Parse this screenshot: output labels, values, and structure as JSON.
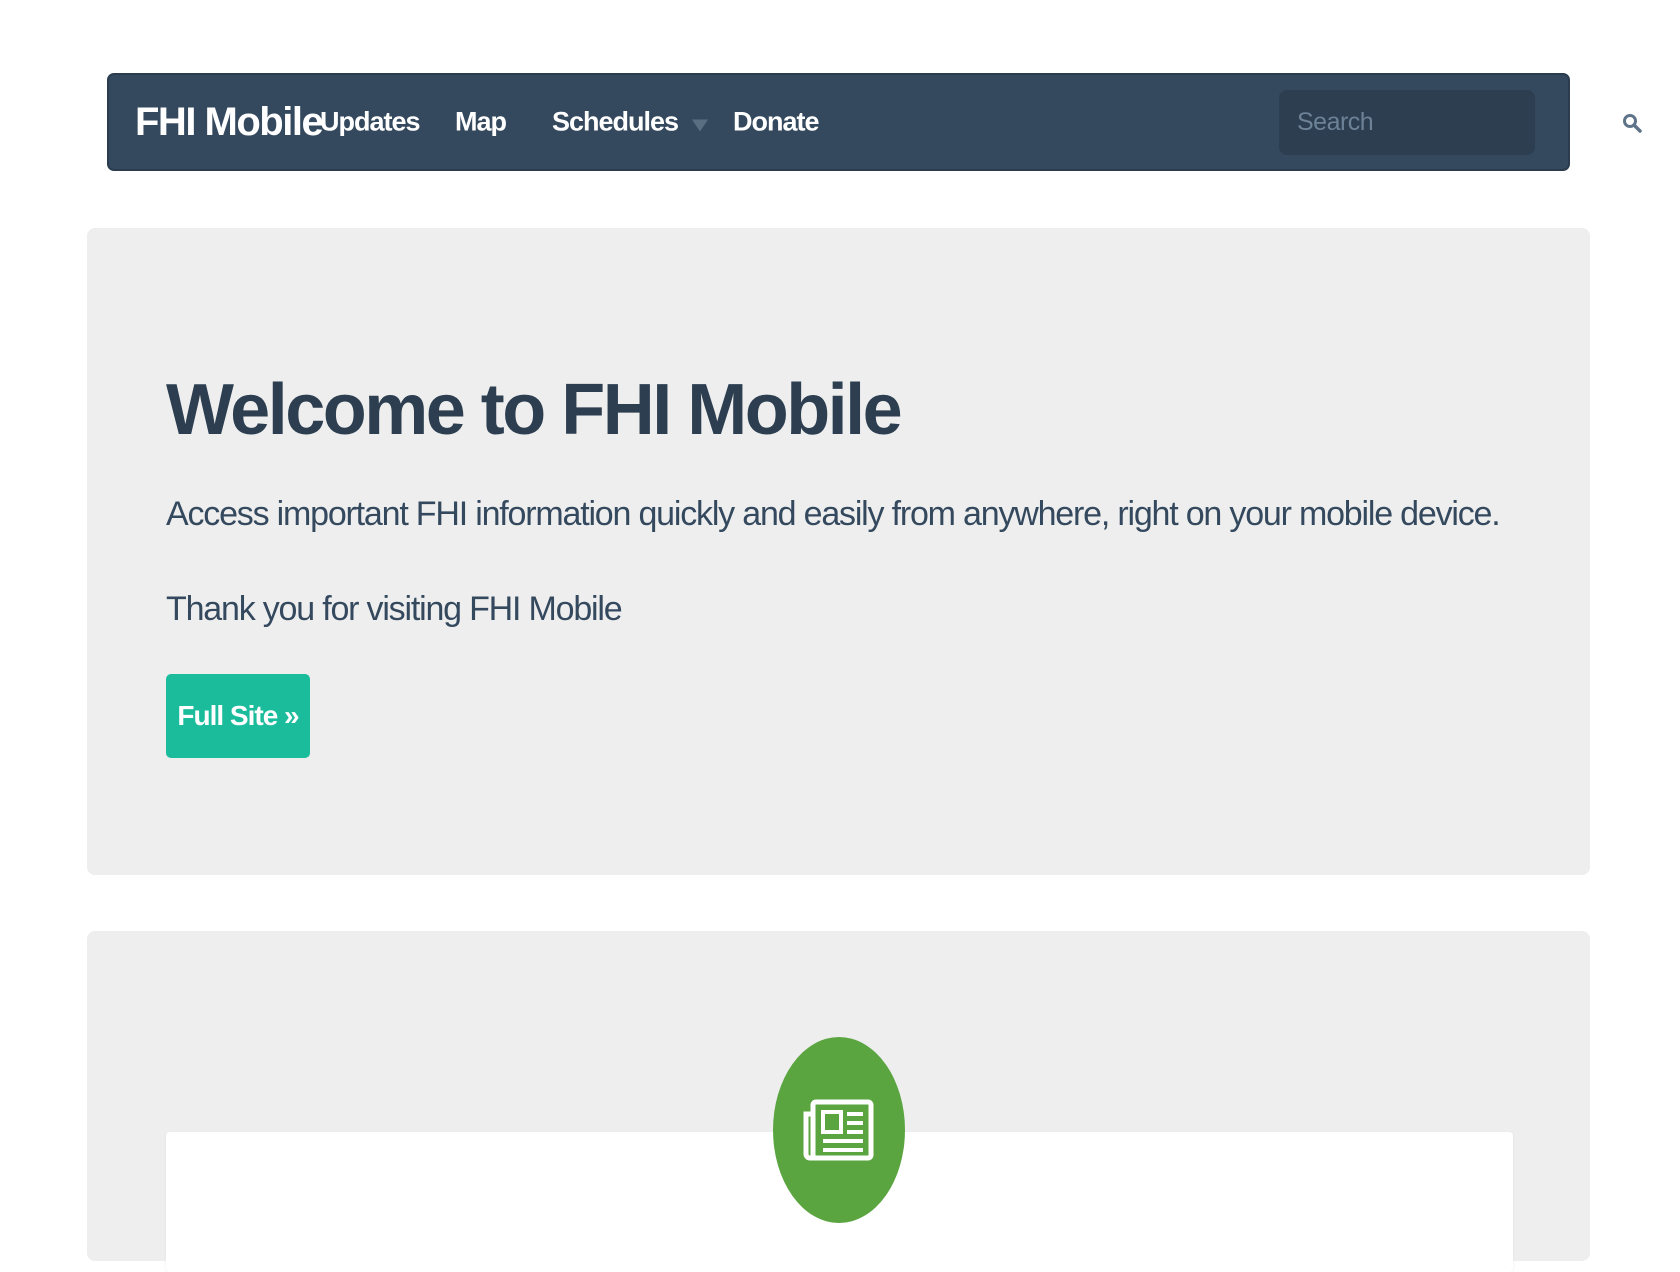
{
  "navbar": {
    "brand": "FHI Mobile",
    "links": [
      {
        "label": "Updates"
      },
      {
        "label": "Map"
      },
      {
        "label": "Schedules",
        "has_dropdown": true
      },
      {
        "label": "Donate"
      }
    ],
    "search": {
      "placeholder": "Search",
      "value": "",
      "icon": "search-icon"
    }
  },
  "hero": {
    "title": "Welcome to FHI Mobile",
    "lead": "Access important FHI information quickly and easily from anywhere, right on your mobile device.",
    "thanks": "Thank you for visiting FHI Mobile",
    "button_label": "Full Site »"
  },
  "updates_panel": {
    "icon": "newspaper-icon"
  },
  "colors": {
    "navbar_bg": "#34495e",
    "accent": "#1abc9c",
    "badge_green": "#5ba541",
    "panel_bg": "#eeeeee",
    "heading": "#2c3e50"
  }
}
